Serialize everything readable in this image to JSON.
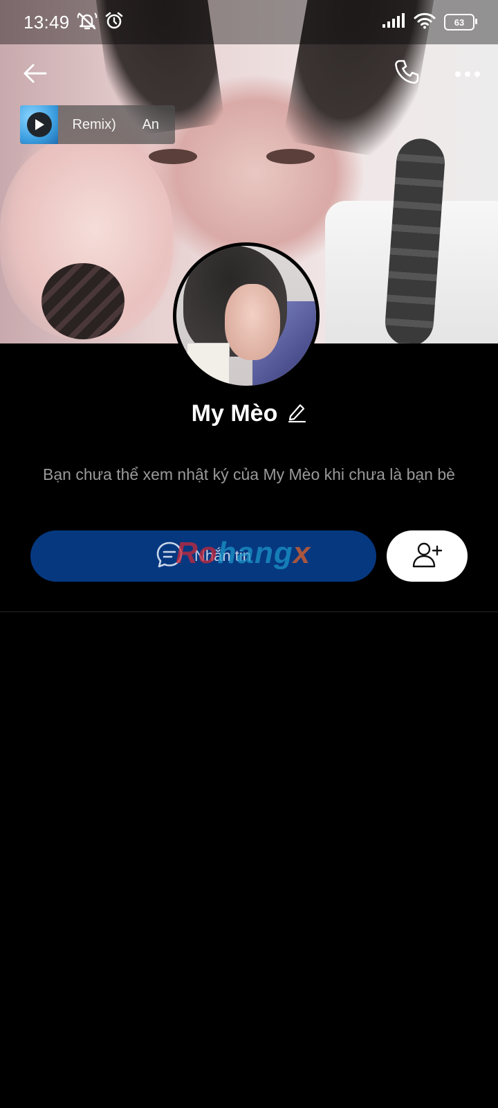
{
  "status_bar": {
    "time": "13:49",
    "battery": "63",
    "icons": [
      "notifications-off-icon",
      "alarm-icon",
      "signal-icon",
      "wifi-icon",
      "battery-icon"
    ]
  },
  "top_nav": {
    "icons": [
      "back-arrow-icon",
      "phone-icon",
      "more-icon"
    ]
  },
  "music": {
    "track_text": "Remix)       An"
  },
  "profile": {
    "name": "My Mèo",
    "privacy_note": "Bạn chưa thể xem nhật ký của My Mèo khi chưa là bạn bè"
  },
  "actions": {
    "message_label": "Nhắn tin"
  },
  "watermark": {
    "part1": "Ro",
    "part2": "hang",
    "part3": "x"
  },
  "colors": {
    "background": "#000000",
    "primary_button": "#063880",
    "secondary_button": "#ffffff",
    "muted_text": "#9a9a9a"
  }
}
